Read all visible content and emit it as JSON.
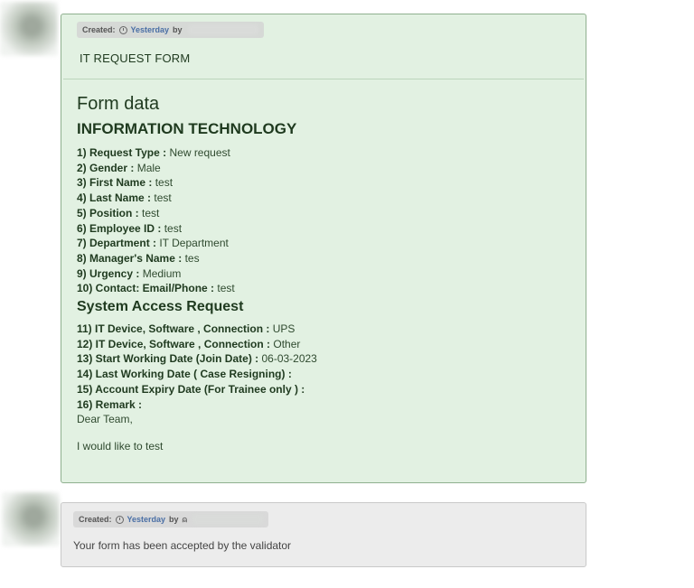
{
  "form_post": {
    "meta": {
      "created_label": "Created:",
      "when": "Yesterday",
      "by": "by"
    },
    "title": "IT REQUEST FORM",
    "heading": "Form data",
    "section1": "INFORMATION TECHNOLOGY",
    "fields1": [
      {
        "label": "1) Request Type :",
        "value": " New request"
      },
      {
        "label": "2) Gender :",
        "value": " Male"
      },
      {
        "label": "3) First Name :",
        "value": " test"
      },
      {
        "label": "4) Last Name :",
        "value": " test"
      },
      {
        "label": "5) Position :",
        "value": " test"
      },
      {
        "label": "6) Employee ID :",
        "value": " test"
      },
      {
        "label": "7) Department :",
        "value": " IT Department"
      },
      {
        "label": "8) Manager's Name :",
        "value": " tes"
      },
      {
        "label": "9) Urgency :",
        "value": " Medium"
      },
      {
        "label": "10) Contact: Email/Phone :",
        "value": " test"
      }
    ],
    "section2": "System Access Request",
    "fields2": [
      {
        "label": "11) IT Device, Software , Connection :",
        "value": " UPS"
      },
      {
        "label": "12) IT Device, Software , Connection :",
        "value": " Other"
      },
      {
        "label": "13) Start Working Date (Join Date) :",
        "value": " 06-03-2023"
      },
      {
        "label": "14) Last Working Date ( Case Resigning) :",
        "value": ""
      },
      {
        "label": "15) Account Expiry Date (For Trainee only ) :",
        "value": ""
      },
      {
        "label": "16) Remark :",
        "value": ""
      }
    ],
    "remark_line1": "Dear Team,",
    "remark_line2": "I would like to test"
  },
  "ack_post": {
    "meta": {
      "created_label": "Created:",
      "when": "Yesterday",
      "by": "by"
    },
    "message": "Your form has been accepted by the validator"
  },
  "colors": {
    "form_bg": "#e2f1e2",
    "form_border": "#8fb08f",
    "ack_bg": "#ececec",
    "link": "#4a6fa5"
  }
}
